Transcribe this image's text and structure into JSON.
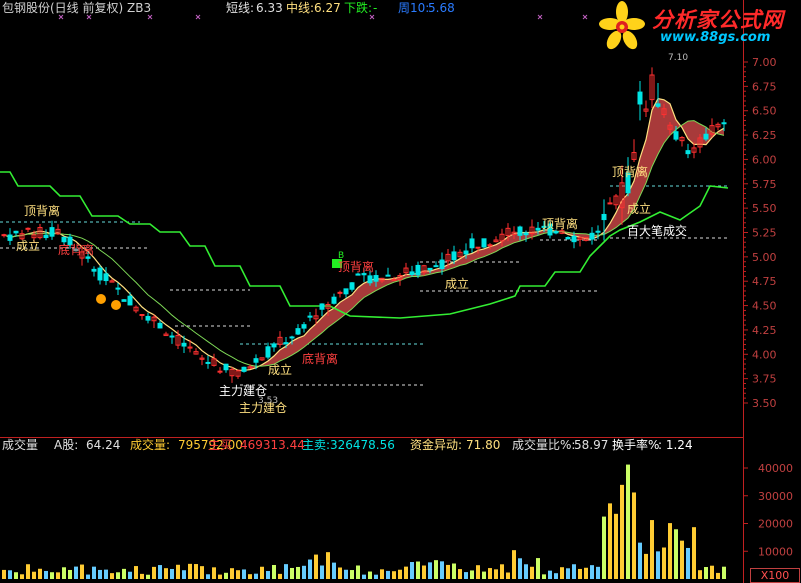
{
  "header": {
    "title": "包钢股份(日线 前复权) ZB3",
    "short_label": "短线:",
    "short_value": "6.33",
    "mid_label": "中线:",
    "mid_value": "6.27",
    "trend_label": "下跌:",
    "trend_value": "-",
    "week_label": "周10:",
    "week_value": "5.68"
  },
  "logo": {
    "title": "分析家公式网",
    "url": "www.88gs.com"
  },
  "price_axis": {
    "ticks": [
      "7.00",
      "6.75",
      "6.50",
      "6.25",
      "6.00",
      "5.75",
      "5.50",
      "5.25",
      "5.00",
      "4.75",
      "4.50",
      "4.25",
      "4.00",
      "3.75",
      "3.50"
    ]
  },
  "annotations": {
    "top_divergence": "顶背离",
    "bottom_divergence": "底背离",
    "established": "成立",
    "main_build": "主力建仓",
    "big_deal": "百大笔成交",
    "low_value": "3.53",
    "high_value": "7.10",
    "buy_mark": "B"
  },
  "volume_header": {
    "label": "成交量",
    "a_share_label": "A股:",
    "a_share_value": "64.24",
    "volume_label": "成交量:",
    "volume_value": "795792.00",
    "buy_label": "主买",
    "buy_value": "469313.44",
    "sell_label": "主卖:",
    "sell_value": "326478.56",
    "flow_label": "资金异动:",
    "flow_value": "71.80",
    "ratio_label": "成交量比%:",
    "ratio_value": "58.97",
    "turnover_label": "换手率%",
    "turnover_value": ": 1.24"
  },
  "volume_axis": {
    "ticks": [
      "40000",
      "30000",
      "20000",
      "10000"
    ],
    "multiplier": "X100"
  },
  "colors": {
    "up": "#ff3030",
    "down": "#00e4e4",
    "ma_band": "#a83a3a",
    "support": "#33ee33",
    "axis": "#c02020",
    "vol_up": "#ffcc33",
    "vol_mid": "#ccff66",
    "vol_down": "#66ccff"
  }
}
